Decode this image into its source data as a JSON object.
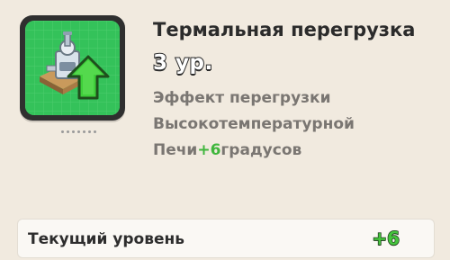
{
  "upgrade": {
    "title": "Термальная перегрузка",
    "level": "3 ур.",
    "description": {
      "line1": "Эффект перегрузки",
      "line2": "Высокотемпературной",
      "line3_prefix": "Печи",
      "line3_value": "+6",
      "line3_suffix": "градусов"
    },
    "icon": "furnace-upgrade-icon"
  },
  "current_level": {
    "label": "Текущий уровень",
    "value": "+6"
  },
  "colors": {
    "background": "#f1eadf",
    "icon_card": "#34c25a",
    "accent_green": "#3fb63c",
    "text_dark": "#2b2b2b",
    "text_muted": "#7a7672"
  }
}
